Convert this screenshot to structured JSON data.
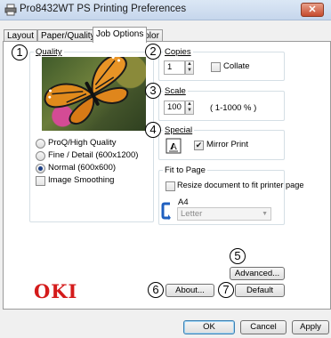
{
  "window": {
    "title": "Pro8432WT PS Printing Preferences",
    "close_glyph": "✕"
  },
  "tabs": [
    {
      "label": "Layout"
    },
    {
      "label": "Paper/Quality"
    },
    {
      "label": "Job Options",
      "active": true
    },
    {
      "label": "Color"
    }
  ],
  "callouts": [
    "1",
    "2",
    "3",
    "4",
    "5",
    "6",
    "7"
  ],
  "quality": {
    "label": "Quality",
    "options": [
      {
        "label": "ProQ/High Quality",
        "selected": false
      },
      {
        "label": "Fine / Detail (600x1200)",
        "selected": false
      },
      {
        "label": "Normal (600x600)",
        "selected": true
      }
    ],
    "image_smoothing": {
      "label": "Image Smoothing",
      "checked": false
    }
  },
  "copies": {
    "label": "Copies",
    "value": "1",
    "collate_label": "Collate",
    "collate_checked": false
  },
  "scale": {
    "label": "Scale",
    "value": "100",
    "range": "( 1-1000 % )"
  },
  "special": {
    "label": "Special",
    "mirror_label": "Mirror Print",
    "mirror_checked": true
  },
  "fit_to_page": {
    "label": "Fit to Page",
    "resize_label": "Resize document to fit printer page",
    "resize_checked": false,
    "paper_size": "A4",
    "target": "Letter"
  },
  "buttons": {
    "advanced": "Advanced...",
    "about": "About...",
    "default": "Default",
    "ok": "OK",
    "cancel": "Cancel",
    "apply": "Apply"
  },
  "brand": {
    "logo": "OKI",
    "color": "#d41b1b"
  },
  "colors": {
    "accent": "#1c3f86",
    "close": "#c64b2e"
  }
}
